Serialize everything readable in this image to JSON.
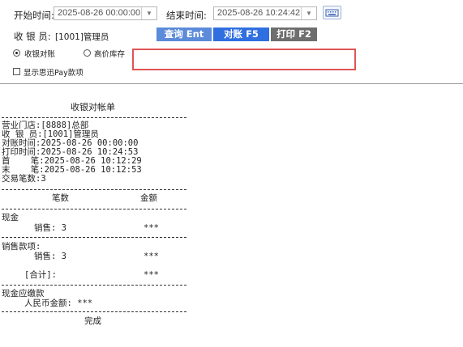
{
  "toolbar": {
    "start_label": "开始时间:",
    "start_value": "2025-08-26 00:00:00",
    "end_label": "结束时间:",
    "end_value": "2025-08-26 10:24:42",
    "cashier_label": "收 银 员:",
    "cashier_value": "[1001]管理员",
    "query_btn": "查询 Ent",
    "reconcile_btn": "对账 F5",
    "print_btn": "打印 F2",
    "radio_reconcile": "收银对账",
    "radio_stock": "高价库存",
    "checkbox_label": "显示思迅Pay款项",
    "search_value": ""
  },
  "receipt": {
    "title": "收银对帐单",
    "store": "营业门店:[8888]总部",
    "cashier": "收 银 员:[1001]管理员",
    "reconcile_time": "对账时间:2025-08-26 00:00:00",
    "print_time": "打印时间:2025-08-26 10:24:53",
    "first": "首    笔:2025-08-26 10:12:29",
    "last": "末    笔:2025-08-26 10:12:53",
    "count": "交易笔数:3",
    "col_count": "笔数",
    "col_amount": "金额",
    "cash": "现金",
    "cash_sales": "销售: 3",
    "cash_sales_amount": "***",
    "sales_items": "销售款项:",
    "items_sales": "销售: 3",
    "items_sales_amount": "***",
    "total_label": "[合计]:",
    "total_amount": "***",
    "cash_due": "现金应缴款",
    "rmb_amount": "人民币金额: ***",
    "done": "完成"
  },
  "colors": {
    "accent_blue": "#5b8bd9",
    "active_blue": "#2f6fe0",
    "gray_button": "#6e6e6e",
    "highlight_red": "#e05555"
  }
}
